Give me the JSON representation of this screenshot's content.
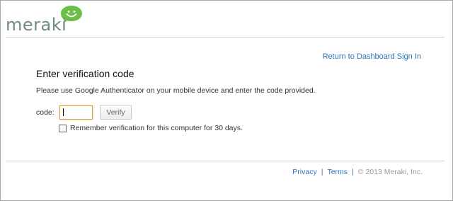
{
  "logo": {
    "text": "meraki",
    "bubble_color": "#6cc04a",
    "text_color": "#6f8a89"
  },
  "header": {
    "return_link": "Return to Dashboard Sign In"
  },
  "main": {
    "title": "Enter verification code",
    "instructions": "Please use Google Authenticator on your mobile device and enter the code provided.",
    "code_label": "code:",
    "code_value": "",
    "verify_label": "Verify",
    "remember_label": "Remember verification for this computer for 30 days.",
    "remember_checked": false
  },
  "footer": {
    "privacy": "Privacy",
    "separator": "|",
    "terms": "Terms",
    "copyright": "© 2013 Meraki, Inc."
  },
  "colors": {
    "link": "#2a73b8",
    "input_focus_border": "#d7a24a"
  }
}
